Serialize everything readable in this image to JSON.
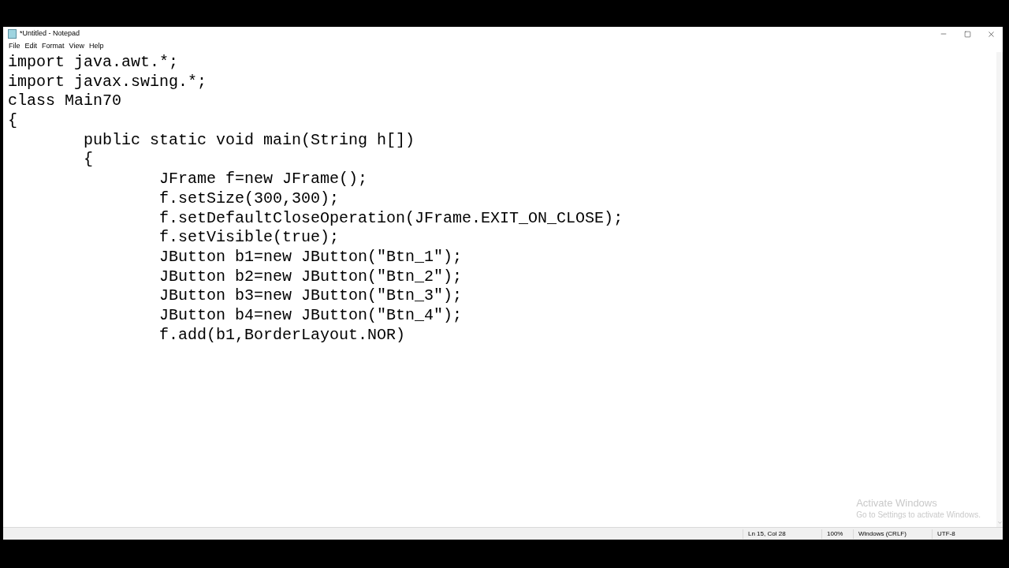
{
  "window": {
    "title": "*Untitled - Notepad"
  },
  "menu": [
    "File",
    "Edit",
    "Format",
    "View",
    "Help"
  ],
  "editor": {
    "lines": [
      "import java.awt.*;",
      "import javax.swing.*;",
      "class Main70",
      "{",
      "\tpublic static void main(String h[])",
      "\t{",
      "\t\tJFrame f=new JFrame();",
      "\t\tf.setSize(300,300);",
      "\t\tf.setDefaultCloseOperation(JFrame.EXIT_ON_CLOSE);",
      "\t\tf.setVisible(true);",
      "\t\tJButton b1=new JButton(\"Btn_1\");",
      "\t\tJButton b2=new JButton(\"Btn_2\");",
      "\t\tJButton b3=new JButton(\"Btn_3\");",
      "\t\tJButton b4=new JButton(\"Btn_4\");",
      "\t\tf.add(b1,BorderLayout.NOR)"
    ]
  },
  "activation_notice": {
    "title": "Activate Windows",
    "message": "Go to Settings to activate Windows."
  },
  "status_bar": [
    "Ln 15, Col 28",
    "100%",
    "Windows (CRLF)",
    "UTF-8"
  ]
}
